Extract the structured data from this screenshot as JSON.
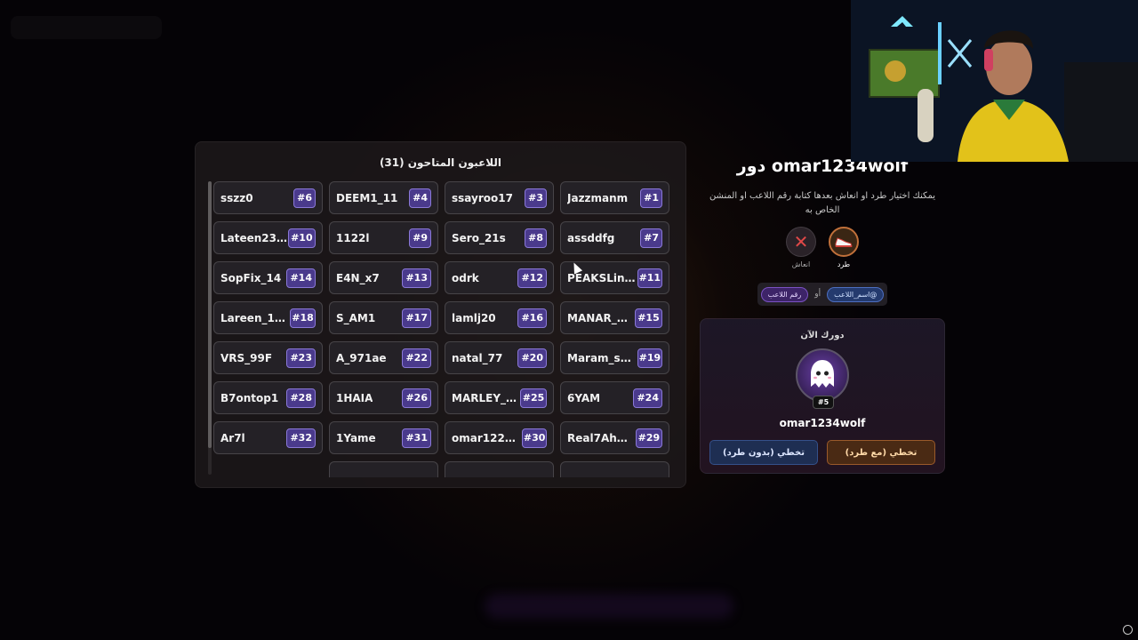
{
  "panel": {
    "title": "اللاعبون المتاحون (31)",
    "players": [
      {
        "name": "sszz0",
        "num": "#6"
      },
      {
        "name": "DEEM1_11",
        "num": "#4"
      },
      {
        "name": "ssayroo17",
        "num": "#3"
      },
      {
        "name": "Jazzmanm",
        "num": "#1"
      },
      {
        "name": "Lateen2325",
        "num": "#10"
      },
      {
        "name": "1122l",
        "num": "#9"
      },
      {
        "name": "Sero_21s",
        "num": "#8"
      },
      {
        "name": "assddfg",
        "num": "#7"
      },
      {
        "name": "SopFix_14",
        "num": "#14"
      },
      {
        "name": "E4N_x7",
        "num": "#13"
      },
      {
        "name": "odrk",
        "num": "#12"
      },
      {
        "name": "PEAKSLino7...",
        "num": "#11"
      },
      {
        "name": "Lareen_111...",
        "num": "#18"
      },
      {
        "name": "S_AM1",
        "num": "#17"
      },
      {
        "name": "lamlj20",
        "num": "#16"
      },
      {
        "name": "MANAR_115",
        "num": "#15"
      },
      {
        "name": "VRS_99F",
        "num": "#23"
      },
      {
        "name": "A_971ae",
        "num": "#22"
      },
      {
        "name": "natal_77",
        "num": "#20"
      },
      {
        "name": "Maram_sxb_...",
        "num": "#19"
      },
      {
        "name": "B7ontop1",
        "num": "#28"
      },
      {
        "name": "1HAIA",
        "num": "#26"
      },
      {
        "name": "MARLEY_110",
        "num": "#25"
      },
      {
        "name": "6YAM",
        "num": "#24"
      },
      {
        "name": "Ar7l",
        "num": "#32"
      },
      {
        "name": "1Yame",
        "num": "#31"
      },
      {
        "name": "omar1223de...",
        "num": "#30"
      },
      {
        "name": "Real7Ahmad",
        "num": "#29"
      }
    ]
  },
  "turn": {
    "title": "دور omar1234wolf",
    "instructions": "يمكنك اختيار طرد او انعاش بعدها كتابة رقم اللاعب او المنشن الخاص به",
    "kick_label": "طرد",
    "revive_label": "انعاش",
    "mention_name": "@اسم_اللاعب",
    "mention_or": "أو",
    "mention_num": "رقم اللاعب",
    "current_label": "دورك الآن",
    "current_badge": "#5",
    "current_name": "omar1234wolf",
    "btn_no_kick": "تخطي (بدون طرد)",
    "btn_kick": "تخطي (مع طرد)"
  },
  "icons": {
    "kick": "sneaker-icon",
    "revive": "cross-icon",
    "avatar": "ghost-icon"
  },
  "colors": {
    "accent_purple": "#4a3a8c",
    "kick_orange": "#c0703a",
    "revive_red": "#e04848",
    "blue_button": "#1e2e52"
  }
}
